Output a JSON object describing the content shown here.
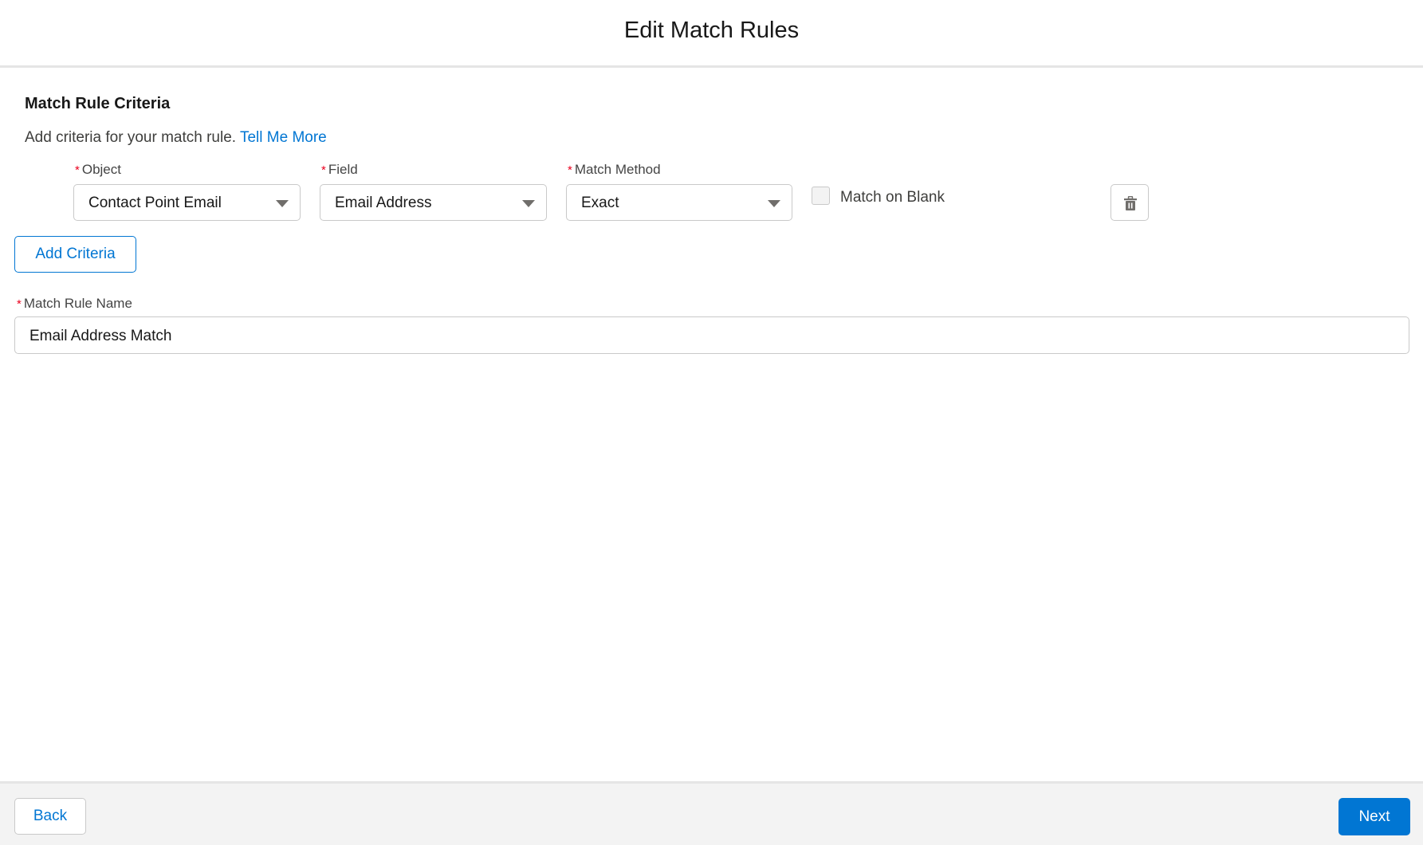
{
  "header": {
    "title": "Edit Match Rules"
  },
  "criteria": {
    "section_title": "Match Rule Criteria",
    "description": "Add criteria for your match rule.",
    "link": "Tell Me More",
    "required_mark": "*",
    "object_label": "Object",
    "object_value": "Contact Point Email",
    "field_label": "Field",
    "field_value": "Email Address",
    "method_label": "Match Method",
    "method_value": "Exact",
    "blank_label": "Match on Blank",
    "blank_checked": false,
    "delete_icon": "trash-icon",
    "add_button": "Add Criteria"
  },
  "name": {
    "label": "Match Rule Name",
    "value": "Email Address Match"
  },
  "footer": {
    "back": "Back",
    "next": "Next"
  },
  "colors": {
    "brand": "#0176d3",
    "required": "#ea001e"
  }
}
